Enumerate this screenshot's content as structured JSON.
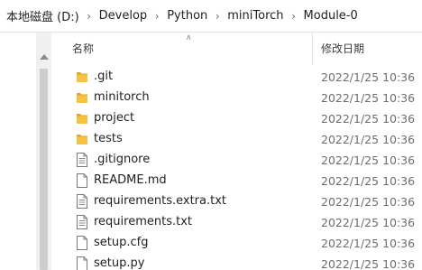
{
  "breadcrumb": [
    "本地磁盘 (D:)",
    "Develop",
    "Python",
    "miniTorch",
    "Module-0"
  ],
  "columns": {
    "name": "名称",
    "date": "修改日期"
  },
  "files": [
    {
      "name": ".git",
      "date": "2022/1/25 10:36",
      "type": "folder",
      "icon": "folder-icon"
    },
    {
      "name": "minitorch",
      "date": "2022/1/25 10:36",
      "type": "folder",
      "icon": "folder-icon"
    },
    {
      "name": "project",
      "date": "2022/1/25 10:36",
      "type": "folder",
      "icon": "folder-icon"
    },
    {
      "name": "tests",
      "date": "2022/1/25 10:36",
      "type": "folder",
      "icon": "folder-icon"
    },
    {
      "name": ".gitignore",
      "date": "2022/1/25 10:36",
      "type": "file",
      "icon": "text-file-icon"
    },
    {
      "name": "README.md",
      "date": "2022/1/25 10:36",
      "type": "file",
      "icon": "blank-file-icon"
    },
    {
      "name": "requirements.extra.txt",
      "date": "2022/1/25 10:36",
      "type": "file",
      "icon": "text-file-icon"
    },
    {
      "name": "requirements.txt",
      "date": "2022/1/25 10:36",
      "type": "file",
      "icon": "text-file-icon"
    },
    {
      "name": "setup.cfg",
      "date": "2022/1/25 10:36",
      "type": "file",
      "icon": "blank-file-icon"
    },
    {
      "name": "setup.py",
      "date": "2022/1/25 10:36",
      "type": "file",
      "icon": "blank-file-icon"
    }
  ],
  "colors": {
    "folder": "#f5c242",
    "folder_dark": "#dda52a",
    "file_border": "#7a7a7a"
  }
}
